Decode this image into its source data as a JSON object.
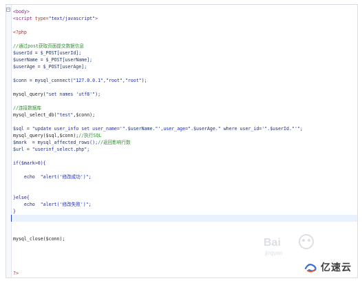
{
  "editor": {
    "fold_symbol": "−",
    "lines": [
      {
        "tokens": [
          {
            "t": "<body>",
            "c": "tag"
          }
        ]
      },
      {
        "tokens": [
          {
            "t": "<script ",
            "c": "tag"
          },
          {
            "t": "type=",
            "c": "attr"
          },
          {
            "t": "\"text/javascript\"",
            "c": "str"
          },
          {
            "t": ">",
            "c": "tag"
          }
        ]
      },
      {
        "tokens": []
      },
      {
        "tokens": [
          {
            "t": "<?php",
            "c": "php"
          }
        ]
      },
      {
        "tokens": []
      },
      {
        "tokens": [
          {
            "t": "//通过post获取页面提交数据信息",
            "c": "cmt"
          }
        ]
      },
      {
        "tokens": [
          {
            "t": "$userId = $_POST[userId];",
            "c": "var"
          }
        ]
      },
      {
        "tokens": [
          {
            "t": "$userName = $_POST[userName];",
            "c": "var"
          }
        ]
      },
      {
        "tokens": [
          {
            "t": "$userAge = $_POST[userAge];",
            "c": "var"
          }
        ]
      },
      {
        "tokens": []
      },
      {
        "tokens": [
          {
            "t": "$conn = mysql_connect(",
            "c": "var"
          },
          {
            "t": "\"127.0.0.1\"",
            "c": "str"
          },
          {
            "t": ",",
            "c": "var"
          },
          {
            "t": "\"root\"",
            "c": "str"
          },
          {
            "t": ",",
            "c": "var"
          },
          {
            "t": "\"root\"",
            "c": "str"
          },
          {
            "t": ");",
            "c": "var"
          }
        ]
      },
      {
        "tokens": []
      },
      {
        "tokens": [
          {
            "t": "mysql_query(",
            "c": "fn"
          },
          {
            "t": "\"set names 'utf8'\"",
            "c": "str"
          },
          {
            "t": ");",
            "c": "fn"
          }
        ]
      },
      {
        "tokens": []
      },
      {
        "tokens": [
          {
            "t": "//连接数据库",
            "c": "cmt"
          }
        ]
      },
      {
        "tokens": [
          {
            "t": "mysql_select_db(",
            "c": "fn"
          },
          {
            "t": "\"test\"",
            "c": "str"
          },
          {
            "t": ",$conn);",
            "c": "fn"
          }
        ]
      },
      {
        "tokens": []
      },
      {
        "tokens": [
          {
            "t": "$sql = ",
            "c": "var"
          },
          {
            "t": "\"update user_info set user_name='\"",
            "c": "str"
          },
          {
            "t": ".$userName.",
            "c": "var"
          },
          {
            "t": "\"',user_age=\"",
            "c": "str"
          },
          {
            "t": ".$userAge.",
            "c": "var"
          },
          {
            "t": "\" where user_id='\"",
            "c": "str"
          },
          {
            "t": ".$userId.",
            "c": "var"
          },
          {
            "t": "\"'\"",
            "c": "str"
          },
          {
            "t": ";",
            "c": "var"
          }
        ]
      },
      {
        "tokens": [
          {
            "t": "mysql_query($sql,$conn);",
            "c": "fn"
          },
          {
            "t": "//执行SQL",
            "c": "cmt"
          }
        ]
      },
      {
        "tokens": [
          {
            "t": "$mark  = mysql_affected_rows();",
            "c": "var"
          },
          {
            "t": "//返回影响行数",
            "c": "cmt"
          }
        ]
      },
      {
        "tokens": [
          {
            "t": "$url = ",
            "c": "var"
          },
          {
            "t": "\"userinf_select.php\"",
            "c": "str"
          },
          {
            "t": ";",
            "c": "var"
          }
        ]
      },
      {
        "tokens": []
      },
      {
        "tokens": [
          {
            "t": "if($mark>0){",
            "c": "kw"
          }
        ]
      },
      {
        "tokens": []
      },
      {
        "tokens": [
          {
            "t": "    echo  ",
            "c": "kw"
          },
          {
            "t": "\"alert('修改成功')\"",
            "c": "str"
          },
          {
            "t": ";",
            "c": "kw"
          }
        ]
      },
      {
        "tokens": []
      },
      {
        "tokens": []
      },
      {
        "tokens": [
          {
            "t": "}else{",
            "c": "kw"
          }
        ]
      },
      {
        "tokens": [
          {
            "t": "    echo  ",
            "c": "kw"
          },
          {
            "t": "\"alert('修改失败')\"",
            "c": "str"
          },
          {
            "t": ";",
            "c": "kw"
          }
        ]
      },
      {
        "tokens": [
          {
            "t": "}",
            "c": "kw"
          }
        ]
      },
      {
        "tokens": [],
        "current": true
      },
      {
        "tokens": []
      },
      {
        "tokens": []
      },
      {
        "tokens": [
          {
            "t": "mysql_close($conn);",
            "c": "fn"
          }
        ]
      },
      {
        "tokens": []
      },
      {
        "tokens": []
      },
      {
        "tokens": []
      },
      {
        "tokens": []
      },
      {
        "tokens": [
          {
            "t": "?>",
            "c": "php"
          }
        ]
      }
    ]
  },
  "watermarks": {
    "baidu_text": "Bai",
    "baidu_sub": "jingyan",
    "yisu_text": "亿速云"
  },
  "colors": {
    "comment": "#2f8f2f",
    "string": "#1a2bbd",
    "php_tag": "#c42020",
    "html_tag": "#8b1d8b",
    "current_line": "#e8f2fe"
  }
}
